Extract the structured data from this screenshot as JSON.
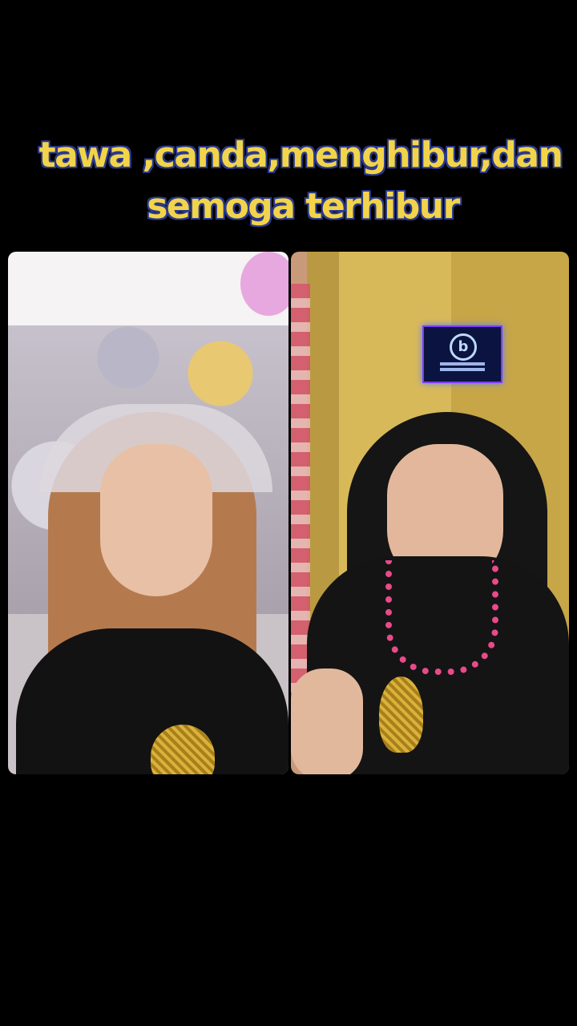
{
  "caption": {
    "line1": "tawa ,canda,menghibur,dan",
    "line2": "semoga terhibur"
  },
  "panels": [
    "left-video",
    "right-video"
  ],
  "colors": {
    "caption_fill": "#f2d44a",
    "caption_outline": "#2b3a8c",
    "background": "#000000"
  }
}
